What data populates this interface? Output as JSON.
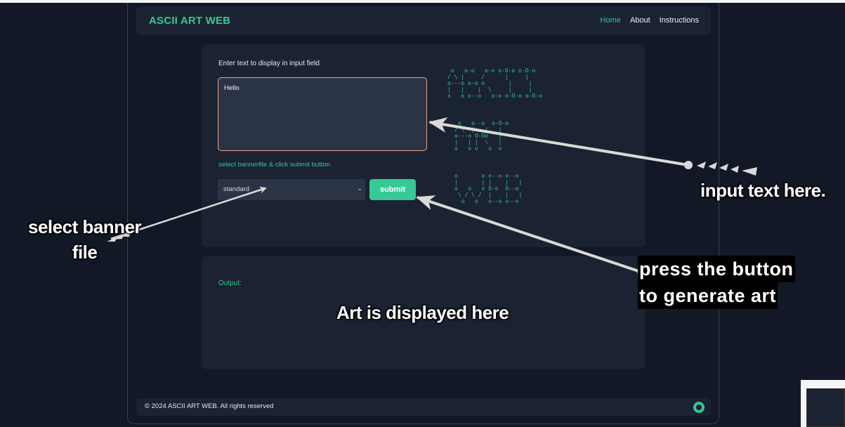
{
  "app": {
    "brand": "ASCII ART WEB",
    "nav": [
      {
        "label": "Home",
        "active": true
      },
      {
        "label": "About",
        "active": false
      },
      {
        "label": "Instructions",
        "active": false
      }
    ]
  },
  "form": {
    "prompt_label": "Enter text to display in input field",
    "input_value": "Hello",
    "select_hint": "select bannerfile & click submit button",
    "banner_selected": "standard",
    "submit_label": "submit"
  },
  "ascii_preview": {
    "line1": " o   o-o   o-o o-O-o o-O-o\n/ \\ |     /      |     |\no---o o-o o       |     |\n|   |    |  \\     |     |\no   o o--o   o-o o-O-o o-O-o",
    "line2": " o   o--o  o-O-o\n/ \\  |   |   |\no---o O-Oo   |\n|   | |  \\   |\no   o o   o  o",
    "line3": "o       o o--o o--o\n|       | |    |   |\no   o   o O-o  O--o\n \\ / \\ /  |    |   |\n  o   o   o--o o--o"
  },
  "output": {
    "label": "Output:"
  },
  "footer": {
    "copyright": "© 2024 ASCII ART WEB. All rights reserved",
    "icon": "github-icon"
  },
  "annotations": {
    "input_hint": "input text here.",
    "select_hint_line1": "select banner",
    "select_hint_line2": "file",
    "art_hint": "Art is displayed here",
    "press_line1": "press the button",
    "press_line2": "to generate art"
  },
  "colors": {
    "accent": "#34c995",
    "background": "#121826",
    "card": "#1b2231",
    "input_border": "#e8a47e"
  }
}
